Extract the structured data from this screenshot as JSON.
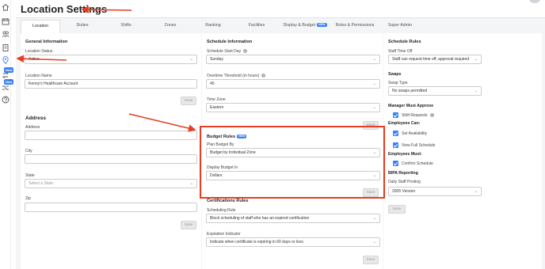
{
  "page": {
    "title": "Location Settings"
  },
  "rail": {
    "new_badge": "New"
  },
  "tabs": [
    {
      "label": "Location",
      "new": false
    },
    {
      "label": "Duties",
      "new": false
    },
    {
      "label": "Shifts",
      "new": false
    },
    {
      "label": "Zones",
      "new": false
    },
    {
      "label": "Ranking",
      "new": false
    },
    {
      "label": "Facilities",
      "new": false
    },
    {
      "label": "Display & Budget",
      "new": true
    },
    {
      "label": "Roles & Permissions",
      "new": false
    },
    {
      "label": "Super Admin",
      "new": false
    }
  ],
  "new_badge": "NEW",
  "general": {
    "heading": "General Information",
    "status_label": "Location Status",
    "status_value": "Active",
    "name_label": "Location Name",
    "name_value": "Kenny's Healthcare Account",
    "save": "Save"
  },
  "address": {
    "heading": "Address",
    "address_label": "Address",
    "city_label": "City",
    "state_label": "State",
    "state_placeholder": "Select a State",
    "zip_label": "Zip",
    "save": "Save"
  },
  "schedule_info": {
    "heading": "Schedule Information",
    "start_day_label": "Schedule Start Day",
    "start_day_value": "Sunday",
    "overtime_label": "Overtime Threshold (in hours)",
    "overtime_value": "40",
    "timezone_label": "Time Zone",
    "timezone_value": "Eastern",
    "save": "Save"
  },
  "budget_rules": {
    "heading": "Budget Rules",
    "plan_label": "Plan Budget By",
    "plan_value": "Budget by Individual Zone",
    "display_label": "Display Budget In",
    "display_value": "Dollars",
    "save": "Save"
  },
  "certifications": {
    "heading": "Certifications Rules",
    "scheduling_label": "Scheduling Rule",
    "scheduling_value": "Block scheduling of staff who has an expired certification",
    "expiration_label": "Expiration Indicator",
    "expiration_value": "Indicate when certificate is expiring in 60 days or less",
    "save": "Save"
  },
  "schedule_rules": {
    "heading": "Schedule Rules",
    "time_off_label": "Staff Time Off",
    "time_off_value": "Staff can request time off; approval required",
    "swaps_heading": "Swaps",
    "swap_type_label": "Swap Type",
    "swap_type_value": "No swaps permitted",
    "manager_heading": "Manager Must Approve",
    "manager_items": [
      "Shift Requests"
    ],
    "employees_can_heading": "Employees Can:",
    "employees_can_items": [
      "Set Availability",
      "View Full Schedule"
    ],
    "employees_must_heading": "Employees Must:",
    "employees_must_items": [
      "Confirm Schedule"
    ],
    "bipa_heading": "BIPA Reporting",
    "posting_label": "Daily Staff Posting",
    "posting_value": "2005 Version",
    "save": "Save"
  },
  "colors": {
    "accent": "#3b82f6",
    "annotation": "#e53e21",
    "panel_bg": "#f4f5f7"
  }
}
